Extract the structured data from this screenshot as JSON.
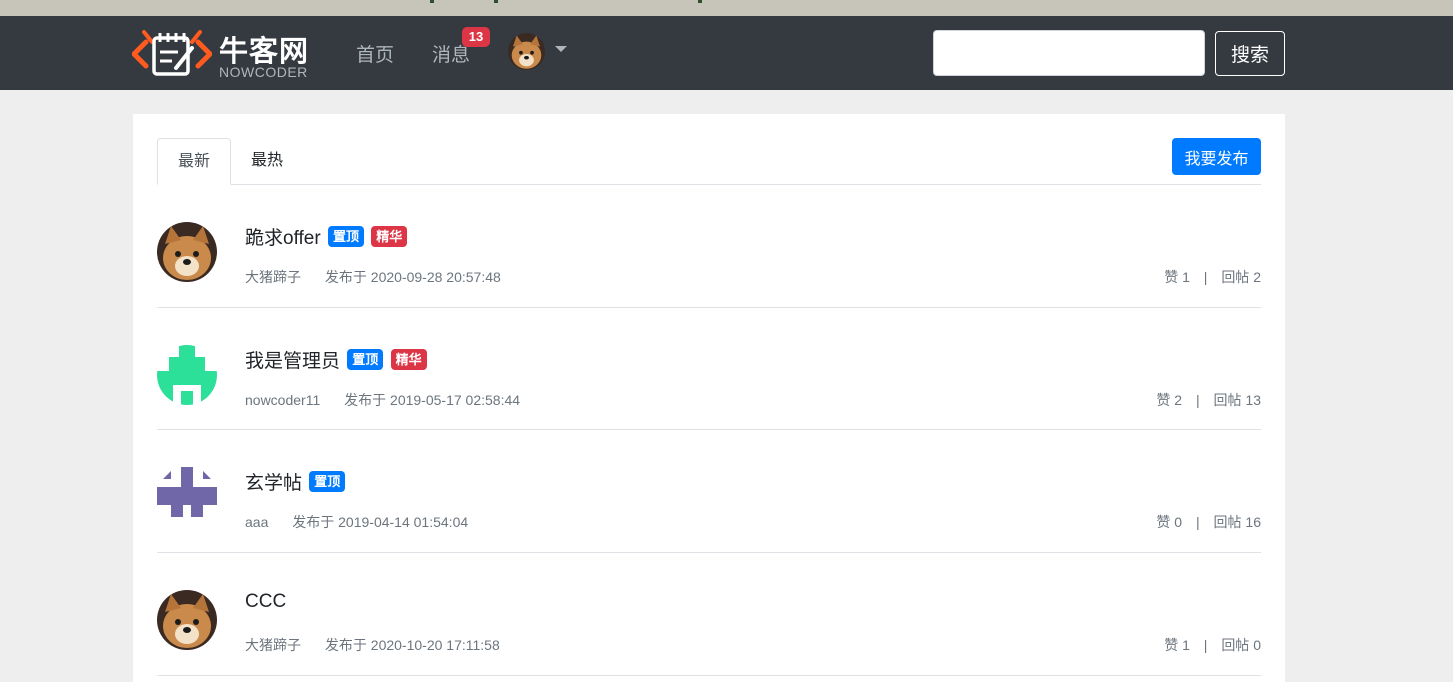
{
  "header": {
    "logo_cn": "牛客网",
    "logo_en": "NOWCODER",
    "nav_home": "首页",
    "nav_messages": "消息",
    "message_count": "13",
    "search_placeholder": "",
    "search_button": "搜索"
  },
  "tabs": [
    {
      "label": "最新",
      "active": true
    },
    {
      "label": "最热",
      "active": false
    }
  ],
  "publish_button": "我要发布",
  "posts": [
    {
      "title": "跪求offer",
      "top": true,
      "good": true,
      "author": "大猪蹄子",
      "published": "发布于 2020-09-28 20:57:48",
      "likes": "赞 1",
      "replies": "回帖 2",
      "avatar": "dog-avatar"
    },
    {
      "title": "我是管理员",
      "top": true,
      "good": true,
      "author": "nowcoder11",
      "published": "发布于 2019-05-17 02:58:44",
      "likes": "赞 2",
      "replies": "回帖 13",
      "avatar": "green-identicon"
    },
    {
      "title": "玄学帖",
      "top": true,
      "good": false,
      "author": "aaa",
      "published": "发布于 2019-04-14 01:54:04",
      "likes": "赞 0",
      "replies": "回帖 16",
      "avatar": "purple-identicon"
    },
    {
      "title": "CCC",
      "top": false,
      "good": false,
      "author": "大猪蹄子",
      "published": "发布于 2020-10-20 17:11:58",
      "likes": "赞 1",
      "replies": "回帖 0",
      "avatar": "dog-avatar"
    }
  ],
  "labels": {
    "badge_top": "置顶",
    "badge_good": "精华",
    "stats_separator": "|"
  },
  "colors": {
    "navbar": "#343a40",
    "primary": "#007bff",
    "danger": "#dc3545",
    "logo_orange": "#ff5a1f"
  }
}
